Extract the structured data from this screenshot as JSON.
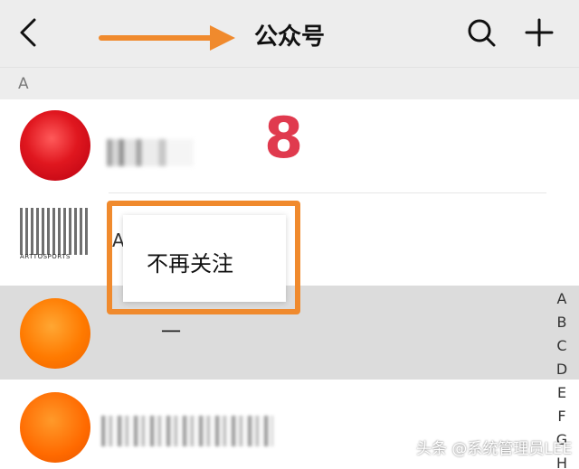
{
  "header": {
    "title": "公众号",
    "back_icon": "chevron-left-icon",
    "search_icon": "search-icon",
    "add_icon": "plus-icon"
  },
  "section": {
    "letter": "A"
  },
  "list": {
    "items": [
      {
        "name_visible": "A_A_",
        "avatar": "red-ball-avatar"
      },
      {
        "name_visible": "A",
        "avatar": "sports-logo-avatar",
        "logo_text": "ARTTOSPORTS"
      },
      {
        "name_visible": "一",
        "avatar": "orange-avatar",
        "highlighted": true
      },
      {
        "name_visible": "",
        "avatar": "orange-avatar"
      }
    ]
  },
  "context_menu": {
    "item_label": "不再关注"
  },
  "annotation": {
    "number": "8",
    "accent": "#f08a2d",
    "number_color": "#e03a4e"
  },
  "index_bar": [
    "A",
    "B",
    "C",
    "D",
    "E",
    "F",
    "G",
    "H"
  ],
  "watermark": "头条 @系统管理员LEE"
}
